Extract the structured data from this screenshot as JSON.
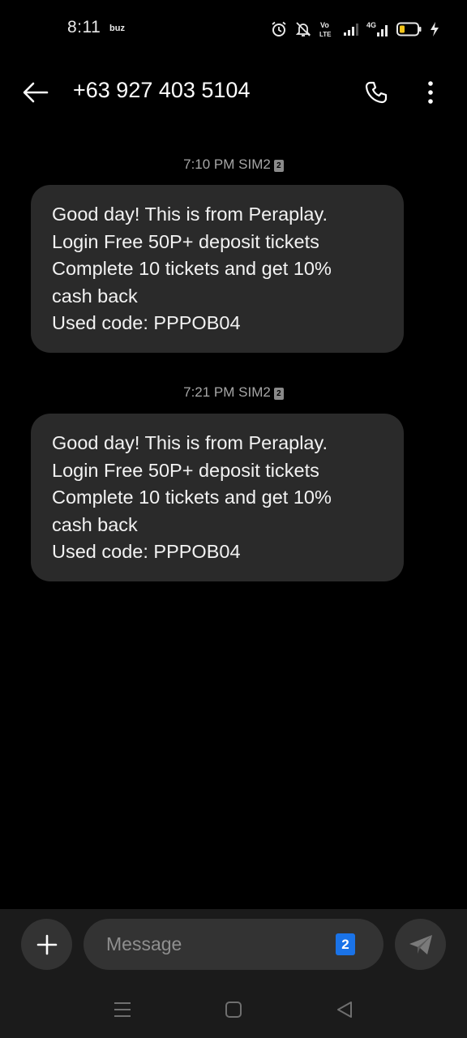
{
  "status_bar": {
    "time": "8:11",
    "app_indicator": "buz",
    "icons": [
      "alarm-icon",
      "mute-icon",
      "volte-icon",
      "signal-sim1-icon",
      "signal-4g-icon",
      "battery-icon",
      "charging-icon"
    ],
    "volte_label": "Vo\nLTE",
    "network_label": "4G",
    "battery_level": 0.25
  },
  "header": {
    "title": "+63 927 403 5104",
    "icons": [
      "back-arrow-icon",
      "phone-icon",
      "more-vert-icon"
    ]
  },
  "messages": [
    {
      "time": "7:10 PM",
      "sim": "SIM2",
      "sim_badge": "2",
      "lines": [
        "Good day! This is from Peraplay.",
        "Login Free 50P+ deposit tickets",
        "Complete 10 tickets and get 10%",
        "cash back",
        "Used code: PPPOB04"
      ]
    },
    {
      "time": "7:21 PM",
      "sim": "SIM2",
      "sim_badge": "2",
      "lines": [
        "Good day! This is from Peraplay.",
        "Login Free 50P+ deposit tickets",
        "Complete 10 tickets and get 10%",
        "cash back",
        "Used code: PPPOB04"
      ]
    }
  ],
  "composer": {
    "placeholder": "Message",
    "value": "",
    "sim_selector": "2",
    "icons": [
      "plus-icon",
      "send-icon"
    ]
  },
  "nav_bar": {
    "icons": [
      "recents-icon",
      "home-icon",
      "back-triangle-icon"
    ]
  },
  "colors": {
    "background": "#000000",
    "bubble": "#2a2a2a",
    "meta_text": "#a6a6a6",
    "composer_bg": "#1b1b1b",
    "control_bg": "#333333",
    "sim_accent": "#1a73e8",
    "battery_fill": "#f5c518"
  }
}
